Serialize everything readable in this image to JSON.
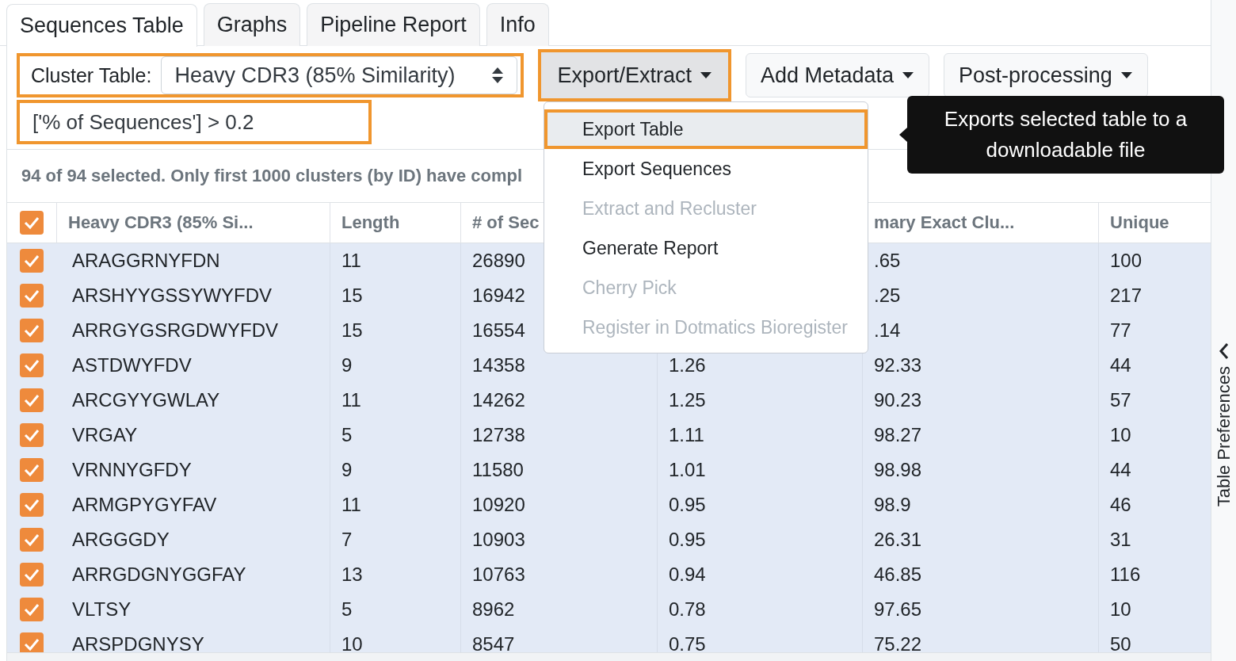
{
  "tabs": [
    {
      "label": "Sequences Table",
      "selected": true
    },
    {
      "label": "Graphs",
      "selected": false
    },
    {
      "label": "Pipeline Report",
      "selected": false
    },
    {
      "label": "Info",
      "selected": false
    }
  ],
  "cluster_table": {
    "label": "Cluster Table:",
    "value": "Heavy CDR3 (85% Similarity)",
    "highlighted": true
  },
  "buttons": [
    {
      "label": "Export/Extract",
      "expanded": true,
      "highlighted": true
    },
    {
      "label": "Add Metadata",
      "expanded": false,
      "highlighted": false
    },
    {
      "label": "Post-processing",
      "expanded": false,
      "highlighted": false
    }
  ],
  "filter": {
    "value": "['% of Sequences'] > 0.2",
    "highlighted": true
  },
  "export_menu": {
    "items": [
      {
        "label": "Export Table",
        "disabled": false,
        "highlighted": true
      },
      {
        "label": "Export Sequences",
        "disabled": false,
        "highlighted": false
      },
      {
        "label": "Extract and Recluster",
        "disabled": true,
        "highlighted": false
      },
      {
        "label": "Generate Report",
        "disabled": false,
        "highlighted": false
      },
      {
        "label": "Cherry Pick",
        "disabled": true,
        "highlighted": false
      },
      {
        "label": "Register in Dotmatics Bioregister",
        "disabled": true,
        "highlighted": false
      }
    ]
  },
  "tooltip": "Exports selected table to a downloadable file",
  "status": "94 of 94 selected. Only first 1000 clusters (by ID) have compl",
  "table": {
    "select_all_checked": true,
    "columns": [
      {
        "label": "Heavy CDR3 (85% Si..."
      },
      {
        "label": "Length"
      },
      {
        "label": "# of Sec"
      },
      {},
      {
        "label": "mary Exact Clu..."
      },
      {
        "label": "Unique"
      }
    ],
    "rows": [
      {
        "checked": true,
        "selected": true,
        "cells": [
          "ARAGGRNYFDN",
          "11",
          "26890",
          null,
          ".65",
          "100"
        ]
      },
      {
        "checked": true,
        "selected": true,
        "cells": [
          "ARSHYYGSSYWYFDV",
          "15",
          "16942",
          null,
          ".25",
          "217"
        ]
      },
      {
        "checked": true,
        "selected": true,
        "cells": [
          "ARRGYGSRGDWYFDV",
          "15",
          "16554",
          null,
          ".14",
          "77"
        ]
      },
      {
        "checked": true,
        "selected": true,
        "cells": [
          "ASTDWYFDV",
          "9",
          "14358",
          "1.26",
          "92.33",
          "44"
        ]
      },
      {
        "checked": true,
        "selected": true,
        "cells": [
          "ARCGYYGWLAY",
          "11",
          "14262",
          "1.25",
          "90.23",
          "57"
        ]
      },
      {
        "checked": true,
        "selected": true,
        "cells": [
          "VRGAY",
          "5",
          "12738",
          "1.11",
          "98.27",
          "10"
        ]
      },
      {
        "checked": true,
        "selected": true,
        "cells": [
          "VRNNYGFDY",
          "9",
          "11580",
          "1.01",
          "98.98",
          "44"
        ]
      },
      {
        "checked": true,
        "selected": true,
        "cells": [
          "ARMGPYGYFAV",
          "11",
          "10920",
          "0.95",
          "98.9",
          "46"
        ]
      },
      {
        "checked": true,
        "selected": true,
        "cells": [
          "ARGGGDY",
          "7",
          "10903",
          "0.95",
          "26.31",
          "31"
        ]
      },
      {
        "checked": true,
        "selected": true,
        "cells": [
          "ARRGDGNYGGFAY",
          "13",
          "10763",
          "0.94",
          "46.85",
          "116"
        ]
      },
      {
        "checked": true,
        "selected": true,
        "cells": [
          "VLTSY",
          "5",
          "8962",
          "0.78",
          "97.65",
          "10"
        ]
      },
      {
        "checked": true,
        "selected": true,
        "cells": [
          "ARSPDGNYSY",
          "10",
          "8547",
          "0.75",
          "75.22",
          "50"
        ]
      }
    ]
  },
  "side_panel": {
    "label": "Table Preferences"
  }
}
